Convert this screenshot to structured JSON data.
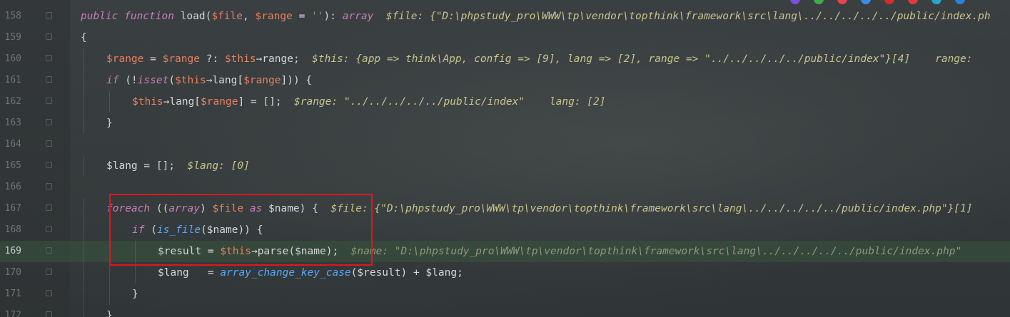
{
  "editor": {
    "lines": [
      {
        "num": "158",
        "indent": 0,
        "tokens": [
          {
            "t": "public ",
            "c": "kwi"
          },
          {
            "t": "function ",
            "c": "kwi"
          },
          {
            "t": "load(",
            "c": "plain"
          },
          {
            "t": "$file",
            "c": "var"
          },
          {
            "t": ", ",
            "c": "plain"
          },
          {
            "t": "$range",
            "c": "var"
          },
          {
            "t": " = ",
            "c": "plain"
          },
          {
            "t": "''",
            "c": "str"
          },
          {
            "t": "): ",
            "c": "plain"
          },
          {
            "t": "array",
            "c": "kwi"
          },
          {
            "t": "  $file: {\"D:\\phpstudy_pro\\WWW\\tp\\vendor\\topthink\\framework\\src\\lang\\../../../../../public/index.ph",
            "c": "hint"
          }
        ]
      },
      {
        "num": "159",
        "indent": 0,
        "tokens": [
          {
            "t": "{",
            "c": "plain"
          }
        ]
      },
      {
        "num": "160",
        "indent": 1,
        "tokens": [
          {
            "t": "$range",
            "c": "var"
          },
          {
            "t": " = ",
            "c": "plain"
          },
          {
            "t": "$range",
            "c": "var"
          },
          {
            "t": " ?: ",
            "c": "plain"
          },
          {
            "t": "$this",
            "c": "var"
          },
          {
            "t": "→range;",
            "c": "plain"
          },
          {
            "t": "  $this: {app => think\\App, config => [9], lang => [2], range => \"../../../../../public/index\"}[4]    range:",
            "c": "hint"
          }
        ]
      },
      {
        "num": "161",
        "indent": 1,
        "tokens": [
          {
            "t": "if ",
            "c": "kwi"
          },
          {
            "t": "(!",
            "c": "plain"
          },
          {
            "t": "isset",
            "c": "kwi"
          },
          {
            "t": "(",
            "c": "plain"
          },
          {
            "t": "$this",
            "c": "var"
          },
          {
            "t": "→lang[",
            "c": "plain"
          },
          {
            "t": "$range",
            "c": "var"
          },
          {
            "t": "])) {",
            "c": "plain"
          }
        ]
      },
      {
        "num": "162",
        "indent": 2,
        "tokens": [
          {
            "t": "$this",
            "c": "var"
          },
          {
            "t": "→lang[",
            "c": "plain"
          },
          {
            "t": "$range",
            "c": "var"
          },
          {
            "t": "] = [];",
            "c": "plain"
          },
          {
            "t": "  $range: \"../../../../../public/index\"    lang: [2]",
            "c": "hint"
          }
        ]
      },
      {
        "num": "163",
        "indent": 1,
        "tokens": [
          {
            "t": "}",
            "c": "plain"
          }
        ]
      },
      {
        "num": "164",
        "indent": 0,
        "tokens": []
      },
      {
        "num": "165",
        "indent": 1,
        "tokens": [
          {
            "t": "$lang",
            "c": "plain"
          },
          {
            "t": " = [];",
            "c": "plain"
          },
          {
            "t": "  $lang: [0]",
            "c": "hint"
          }
        ]
      },
      {
        "num": "166",
        "indent": 0,
        "tokens": []
      },
      {
        "num": "167",
        "indent": 1,
        "tokens": [
          {
            "t": "foreach ",
            "c": "kwi"
          },
          {
            "t": "((",
            "c": "plain"
          },
          {
            "t": "array",
            "c": "kwi"
          },
          {
            "t": ") ",
            "c": "plain"
          },
          {
            "t": "$file",
            "c": "var"
          },
          {
            "t": " as ",
            "c": "kwi"
          },
          {
            "t": "$name",
            "c": "plain"
          },
          {
            "t": ") {",
            "c": "plain"
          },
          {
            "t": "  $file: {\"D:\\phpstudy_pro\\WWW\\tp\\vendor\\topthink\\framework\\src\\lang\\../../../../../public/index.php\"}[1]",
            "c": "hint"
          }
        ]
      },
      {
        "num": "168",
        "indent": 2,
        "tokens": [
          {
            "t": "if ",
            "c": "kwi"
          },
          {
            "t": "(",
            "c": "plain"
          },
          {
            "t": "is_file",
            "c": "fni"
          },
          {
            "t": "(",
            "c": "plain"
          },
          {
            "t": "$name",
            "c": "plain"
          },
          {
            "t": ")) {",
            "c": "plain"
          }
        ]
      },
      {
        "num": "169",
        "indent": 3,
        "current": true,
        "tokens": [
          {
            "t": "$result",
            "c": "plain"
          },
          {
            "t": " = ",
            "c": "plain"
          },
          {
            "t": "$this",
            "c": "var"
          },
          {
            "t": "→parse(",
            "c": "plain"
          },
          {
            "t": "$name",
            "c": "plain"
          },
          {
            "t": ");",
            "c": "plain"
          },
          {
            "t": "  $name: \"D:\\phpstudy_pro\\WWW\\tp\\vendor\\topthink\\framework\\src\\lang\\../../../../../public/index.php\"",
            "c": "hint-dim"
          }
        ]
      },
      {
        "num": "170",
        "indent": 3,
        "tokens": [
          {
            "t": "$lang",
            "c": "plain"
          },
          {
            "t": "   = ",
            "c": "plain"
          },
          {
            "t": "array_change_key_case",
            "c": "fni"
          },
          {
            "t": "(",
            "c": "plain"
          },
          {
            "t": "$result",
            "c": "plain"
          },
          {
            "t": ") + ",
            "c": "plain"
          },
          {
            "t": "$lang",
            "c": "plain"
          },
          {
            "t": ";",
            "c": "plain"
          }
        ]
      },
      {
        "num": "171",
        "indent": 2,
        "tokens": [
          {
            "t": "}",
            "c": "plain"
          }
        ]
      },
      {
        "num": "172",
        "indent": 1,
        "tokens": [
          {
            "t": "}",
            "c": "plain"
          }
        ]
      }
    ]
  },
  "colors": {
    "highlight_box": "#e0161c",
    "current_line": "#38533c"
  },
  "tray_icons": [
    "app-icon-purple",
    "chrome-icon",
    "browser-icon-red",
    "browser-icon-blue",
    "opera-icon",
    "vivaldi-icon",
    "app-icon-teal",
    "edge-icon"
  ]
}
